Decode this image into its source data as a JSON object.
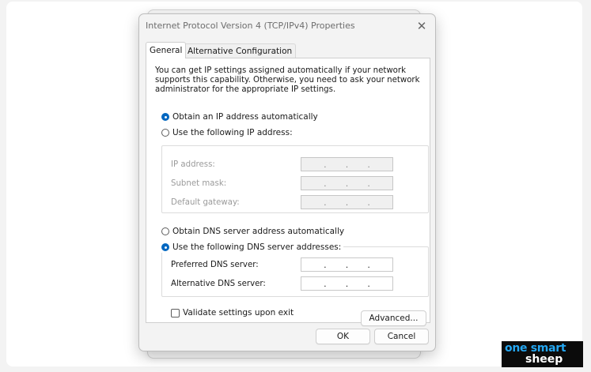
{
  "dialog": {
    "title": "Internet Protocol Version 4 (TCP/IPv4) Properties",
    "close_glyph": "✕",
    "tabs": [
      {
        "label": "General"
      },
      {
        "label": "Alternative Configuration"
      }
    ],
    "intro_text": "You can get IP settings assigned automatically if your network supports this capability. Otherwise, you need to ask your network administrator for the appropriate IP settings.",
    "ip_options": {
      "auto_label": "Obtain an IP address automatically",
      "manual_label": "Use the following IP address:",
      "selected": "auto"
    },
    "ip_fields": [
      {
        "label": "IP address:",
        "value": ".     .     ."
      },
      {
        "label": "Subnet mask:",
        "value": ".     .     ."
      },
      {
        "label": "Default gateway:",
        "value": ".     .     ."
      }
    ],
    "dns_options": {
      "auto_label": "Obtain DNS server address automatically",
      "manual_label": "Use the following DNS server addresses:",
      "selected": "manual"
    },
    "dns_fields": [
      {
        "label": "Preferred DNS server:",
        "value": ".     .     ."
      },
      {
        "label": "Alternative DNS server:",
        "value": ".     .     ."
      }
    ],
    "validate_label": "Validate settings upon exit",
    "validate_checked": false,
    "advanced_label": "Advanced...",
    "ok_label": "OK",
    "cancel_label": "Cancel"
  },
  "watermark": {
    "line1": "one smart",
    "line2": "sheep"
  },
  "colors": {
    "accent": "#0067c0",
    "logo_blue": "#24a7f2"
  }
}
